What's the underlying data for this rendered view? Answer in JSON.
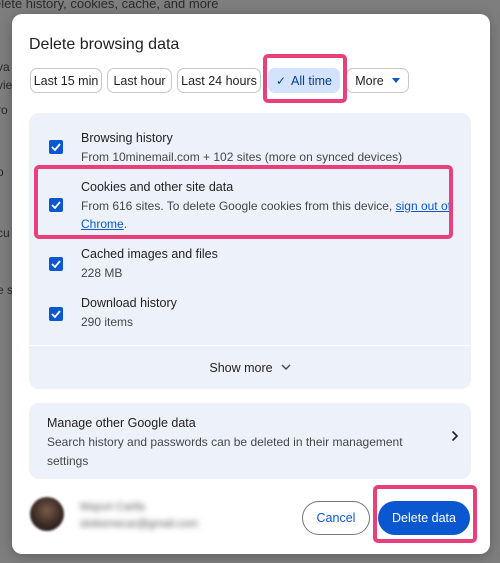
{
  "background": {
    "top_text": "elete history, cookies, cache, and more",
    "fragments": [
      "va",
      "vie",
      "ro",
      "p",
      "cu",
      "e s"
    ]
  },
  "dialog": {
    "title": "Delete browsing data",
    "time_ranges": [
      {
        "label": "Last 15 min",
        "selected": false
      },
      {
        "label": "Last hour",
        "selected": false
      },
      {
        "label": "Last 24 hours",
        "selected": false
      },
      {
        "label": "All time",
        "selected": true
      },
      {
        "label": "More",
        "selected": false
      }
    ],
    "items": [
      {
        "title": "Browsing history",
        "desc": "From 10minemail.com + 102 sites (more on synced devices)",
        "checked": true
      },
      {
        "title": "Cookies and other site data",
        "desc_prefix": "From 616 sites. To delete Google cookies from this device, ",
        "link": "sign out of Chrome",
        "desc_suffix": ".",
        "checked": true
      },
      {
        "title": "Cached images and files",
        "desc": "228 MB",
        "checked": true
      },
      {
        "title": "Download history",
        "desc": "290 items",
        "checked": true
      }
    ],
    "show_more": "Show more",
    "manage": {
      "title": "Manage other Google data",
      "desc": "Search history and passwords can be deleted in their management settings"
    },
    "account": {
      "name": "Mayuri Carlla",
      "email": "stokemecar@gmail.com"
    },
    "cancel_label": "Cancel",
    "delete_label": "Delete data"
  },
  "colors": {
    "accent": "#0b57d0",
    "highlight": "#e8407a",
    "panel": "#edf2fa",
    "chip_selected": "#d3e3fd"
  }
}
